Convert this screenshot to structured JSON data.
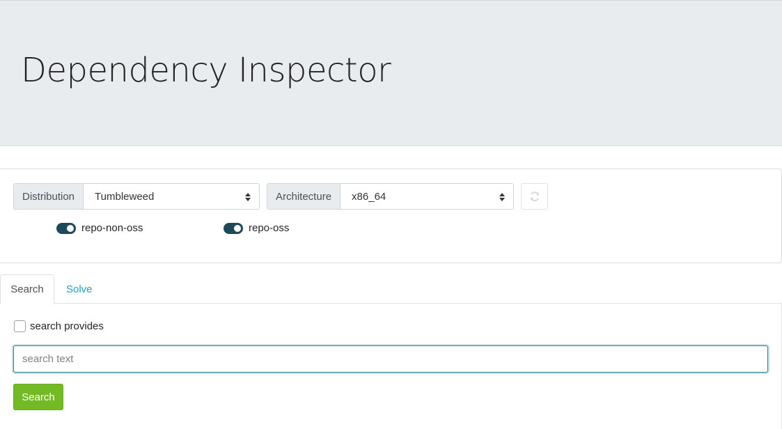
{
  "header": {
    "title": "Dependency Inspector"
  },
  "config": {
    "distribution": {
      "label": "Distribution",
      "selected": "Tumbleweed"
    },
    "architecture": {
      "label": "Architecture",
      "selected": "x86_64"
    },
    "refresh_icon": "refresh-icon",
    "repos": [
      {
        "label": "repo-non-oss",
        "enabled": true
      },
      {
        "label": "repo-oss",
        "enabled": true
      }
    ]
  },
  "tabs": [
    {
      "label": "Search",
      "active": true
    },
    {
      "label": "Solve",
      "active": false
    }
  ],
  "search": {
    "provides_label": "search provides",
    "provides_checked": false,
    "placeholder": "search text",
    "value": "",
    "button_label": "Search"
  },
  "colors": {
    "accent": "#73ba25",
    "toggle_on": "#1c4a5a",
    "link": "#1aa3c4",
    "header_bg": "#e9ecef"
  }
}
